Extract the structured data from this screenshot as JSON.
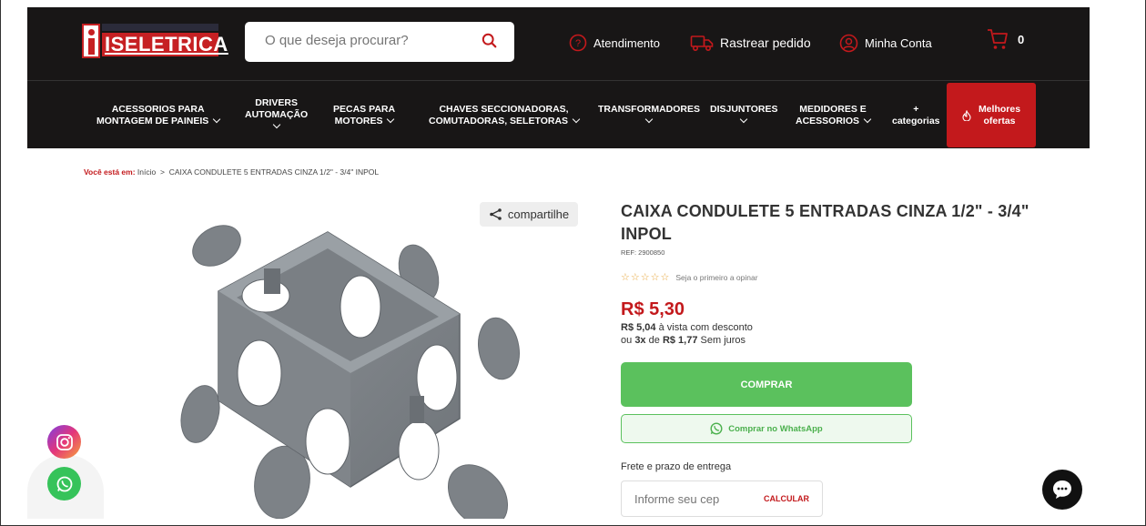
{
  "header": {
    "logo_text": "ISELETRICA",
    "search_placeholder": "O que deseja procurar?",
    "links": {
      "atendimento": "Atendimento",
      "rastrear": "Rastrear pedido",
      "conta": "Minha Conta"
    },
    "cart_count": "0"
  },
  "nav": {
    "items": [
      {
        "label_l1": "ACESSORIOS PARA",
        "label_l2": "MONTAGEM DE PAINEIS"
      },
      {
        "label_l1": "DRIVERS",
        "label_l2": "AUTOMAÇÃO"
      },
      {
        "label_l1": "PECAS PARA",
        "label_l2": "MOTORES"
      },
      {
        "label_l1": "CHAVES SECCIONADORAS,",
        "label_l2": "COMUTADORAS, SELETORAS"
      },
      {
        "label_l1": "TRANSFORMADORES",
        "label_l2": ""
      },
      {
        "label_l1": "DISJUNTORES",
        "label_l2": ""
      },
      {
        "label_l1": "MEDIDORES E",
        "label_l2": "ACESSORIOS"
      },
      {
        "label_l1": "+",
        "label_l2": "categorias"
      }
    ],
    "best": {
      "label_l1": "Melhores",
      "label_l2": "ofertas"
    }
  },
  "breadcrumb": {
    "prefix": "Você está em:",
    "home": "Início",
    "separator": ">",
    "current": "CAIXA CONDULETE 5 ENTRADAS CINZA 1/2\" - 3/4\" INPOL"
  },
  "product": {
    "share_label": "compartilhe",
    "title": "CAIXA CONDULETE 5 ENTRADAS CINZA 1/2\" - 3/4\" INPOL",
    "ref": "REF: 2900850",
    "stars": "☆☆☆☆☆",
    "rating_text": "Seja o primeiro a opinar",
    "price": "R$ 5,30",
    "pix_price": "R$ 5,04",
    "pix_text": "à vista com desconto",
    "installments_prefix": "ou",
    "installments_count": "3x",
    "installments_mid": "de",
    "installments_value": "R$ 1,77",
    "installments_suffix": "Sem juros",
    "buy_label": "COMPRAR",
    "whatsapp_label": "Comprar no WhatsApp",
    "shipping_label": "Frete e prazo de entrega",
    "cep_placeholder": "Informe seu cep",
    "calc_label": "CALCULAR"
  },
  "colors": {
    "brand_red": "#c3191c",
    "header_bg": "#181616",
    "buy_green": "#5bc15d"
  }
}
